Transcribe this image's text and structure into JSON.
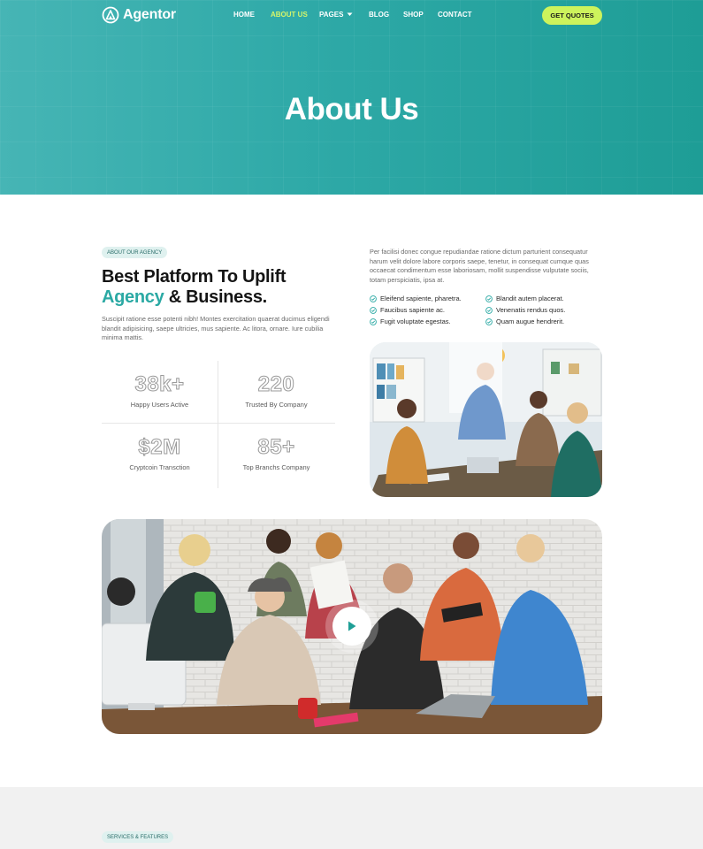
{
  "header": {
    "brand": "Agentor",
    "nav": [
      {
        "label": "HOME",
        "active": false
      },
      {
        "label": "ABOUT US",
        "active": true
      },
      {
        "label": "PAGES",
        "active": false,
        "has_dropdown": true
      },
      {
        "label": "BLOG",
        "active": false
      },
      {
        "label": "SHOP",
        "active": false
      },
      {
        "label": "CONTACT",
        "active": false
      }
    ],
    "cta_label": "GET QUOTES"
  },
  "hero": {
    "title": "About Us"
  },
  "about": {
    "badge": "ABOUT OUR AGENCY",
    "heading_line1": "Best Platform To Uplift",
    "heading_accent": "Agency",
    "heading_rest": " & Business.",
    "intro": "Suscipit ratione esse potenti nibh! Montes exercitation quaerat ducimus eligendi blandit adipisicing, saepe ultricies, mus sapiente. Ac litora, ornare. Iure cubilia minima mattis.",
    "stats": [
      {
        "value": "38k+",
        "label": "Happy Users Active"
      },
      {
        "value": "220",
        "label": "Trusted By Company"
      },
      {
        "value": "$2M",
        "label": "Cryptcoin Transction"
      },
      {
        "value": "85+",
        "label": "Top Branchs Company"
      }
    ],
    "paragraph": "Per facilisi donec congue repudiandae ratione dictum parturient consequatur harum velit dolore labore corporis saepe, tenetur, in consequat cumque quas occaecat condimentum esse laboriosam, mollit suspendisse vulputate sociis, totam perspiciatis, ipsa at.",
    "checklist": [
      "Eleifend sapiente, pharetra.",
      "Blandit autem placerat.",
      "Faucibus sapiente ac.",
      "Venenatis rendus quos.",
      "Fugit voluptate egestas.",
      "Quam augue hendrerit."
    ]
  },
  "services": {
    "badge": "SERVICES & FEATURES"
  },
  "colors": {
    "teal": "#2ea9a7",
    "lime": "#cdf35c",
    "accent_text": "#2ba9a4"
  }
}
